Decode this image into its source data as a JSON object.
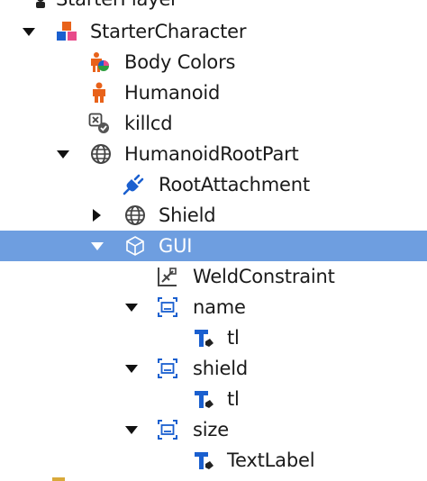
{
  "explorer": {
    "items": [
      {
        "label": "StarterPlayer"
      },
      {
        "label": "StarterCharacter"
      },
      {
        "label": "Body Colors"
      },
      {
        "label": "Humanoid"
      },
      {
        "label": "killcd"
      },
      {
        "label": "HumanoidRootPart"
      },
      {
        "label": "RootAttachment"
      },
      {
        "label": "Shield"
      },
      {
        "label": "GUI"
      },
      {
        "label": "WeldConstraint"
      },
      {
        "label": "name"
      },
      {
        "label": "tl"
      },
      {
        "label": "shield"
      },
      {
        "label": "tl"
      },
      {
        "label": "size"
      },
      {
        "label": "TextLabel"
      }
    ],
    "selected": "GUI"
  },
  "colors": {
    "selection": "#6e9ee0",
    "orange": "#e8621a",
    "blue": "#1a5fcf",
    "text": "#1a1a1a"
  }
}
